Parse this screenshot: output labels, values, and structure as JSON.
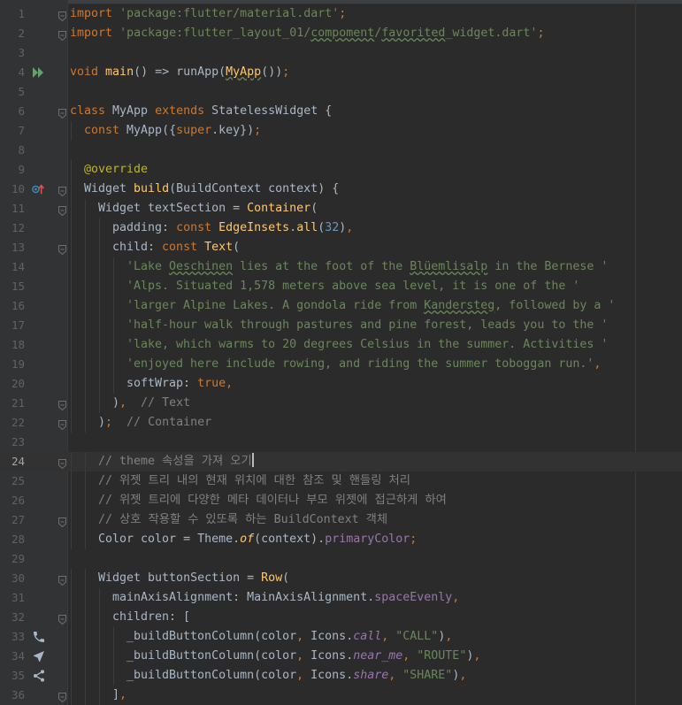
{
  "editor": {
    "current_line": 24,
    "lines": [
      {
        "n": "1",
        "tokens": [
          [
            "kw",
            "import"
          ],
          [
            "p",
            " "
          ],
          [
            "str",
            "'package:flutter/material.dart'"
          ],
          [
            "kw",
            ";"
          ]
        ],
        "fold": true
      },
      {
        "n": "2",
        "tokens": [
          [
            "kw",
            "import"
          ],
          [
            "p",
            " "
          ],
          [
            "str",
            "'package:flutter_layout_01/"
          ],
          [
            "strul",
            "compoment"
          ],
          [
            "str",
            "/"
          ],
          [
            "strul",
            "favorited"
          ],
          [
            "str",
            "_widget.dart'"
          ],
          [
            "kw",
            ";"
          ]
        ],
        "fold": true
      },
      {
        "n": "3",
        "tokens": []
      },
      {
        "n": "4",
        "tokens": [
          [
            "kw",
            "void"
          ],
          [
            "p",
            " "
          ],
          [
            "fn",
            "main"
          ],
          [
            "p",
            "() => runApp("
          ],
          [
            "fnul",
            "MyApp"
          ],
          [
            "p",
            "())"
          ],
          [
            "kw",
            ";"
          ]
        ],
        "icon": "run-icon"
      },
      {
        "n": "5",
        "tokens": []
      },
      {
        "n": "6",
        "tokens": [
          [
            "kw",
            "class"
          ],
          [
            "p",
            " MyApp "
          ],
          [
            "kw",
            "extends"
          ],
          [
            "p",
            " StatelessWidget {"
          ]
        ],
        "fold": true
      },
      {
        "n": "7",
        "indent": 1,
        "tokens": [
          [
            "kw",
            "const"
          ],
          [
            "p",
            " MyApp({"
          ],
          [
            "kw",
            "super"
          ],
          [
            "p",
            ".key})"
          ],
          [
            "kw",
            ";"
          ]
        ]
      },
      {
        "n": "8",
        "tokens": []
      },
      {
        "n": "9",
        "indent": 1,
        "tokens": [
          [
            "ann",
            "@override"
          ]
        ]
      },
      {
        "n": "10",
        "indent": 1,
        "tokens": [
          [
            "p",
            "Widget "
          ],
          [
            "fn",
            "build"
          ],
          [
            "p",
            "(BuildContext context) {"
          ]
        ],
        "icon": "override-icon",
        "fold": true
      },
      {
        "n": "11",
        "indent": 2,
        "tokens": [
          [
            "p",
            "Widget textSection = "
          ],
          [
            "fn",
            "Container"
          ],
          [
            "p",
            "("
          ]
        ],
        "fold": true
      },
      {
        "n": "12",
        "indent": 3,
        "tokens": [
          [
            "p",
            "padding: "
          ],
          [
            "kw",
            "const"
          ],
          [
            "p",
            " "
          ],
          [
            "fn",
            "EdgeInsets"
          ],
          [
            "p",
            "."
          ],
          [
            "fn",
            "all"
          ],
          [
            "p",
            "("
          ],
          [
            "num",
            "32"
          ],
          [
            "p",
            ")"
          ],
          [
            "kw",
            ","
          ]
        ]
      },
      {
        "n": "13",
        "indent": 3,
        "tokens": [
          [
            "p",
            "child: "
          ],
          [
            "kw",
            "const"
          ],
          [
            "p",
            " "
          ],
          [
            "fn",
            "Text"
          ],
          [
            "p",
            "("
          ]
        ],
        "fold": true
      },
      {
        "n": "14",
        "indent": 4,
        "tokens": [
          [
            "str",
            "'Lake "
          ],
          [
            "strul",
            "Oeschinen"
          ],
          [
            "str",
            " lies at the foot of the "
          ],
          [
            "strul",
            "Blüemlisalp"
          ],
          [
            "str",
            " in the Bernese '"
          ]
        ]
      },
      {
        "n": "15",
        "indent": 4,
        "tokens": [
          [
            "str",
            "'Alps. Situated 1,578 meters above sea level, it is one of the '"
          ]
        ]
      },
      {
        "n": "16",
        "indent": 4,
        "tokens": [
          [
            "str",
            "'larger Alpine Lakes. A gondola ride from "
          ],
          [
            "strul",
            "Kandersteg"
          ],
          [
            "str",
            ", followed by a '"
          ]
        ]
      },
      {
        "n": "17",
        "indent": 4,
        "tokens": [
          [
            "str",
            "'half-hour walk through pastures and pine forest, leads you to the '"
          ]
        ]
      },
      {
        "n": "18",
        "indent": 4,
        "tokens": [
          [
            "str",
            "'lake, which warms to 20 degrees Celsius in the summer. Activities '"
          ]
        ]
      },
      {
        "n": "19",
        "indent": 4,
        "tokens": [
          [
            "str",
            "'enjoyed here include rowing, and riding the summer toboggan run.'"
          ],
          [
            "kw",
            ","
          ]
        ]
      },
      {
        "n": "20",
        "indent": 4,
        "tokens": [
          [
            "p",
            "softWrap: "
          ],
          [
            "kw",
            "true"
          ],
          [
            "kw",
            ","
          ]
        ]
      },
      {
        "n": "21",
        "indent": 3,
        "tokens": [
          [
            "p",
            ")"
          ],
          [
            "kw",
            ","
          ],
          [
            "p",
            "  "
          ],
          [
            "cm",
            "// Text"
          ]
        ],
        "fold": true
      },
      {
        "n": "22",
        "indent": 2,
        "tokens": [
          [
            "p",
            ")"
          ],
          [
            "kw",
            ";"
          ],
          [
            "p",
            "  "
          ],
          [
            "cm",
            "// Container"
          ]
        ],
        "fold": true
      },
      {
        "n": "23",
        "tokens": []
      },
      {
        "n": "24",
        "indent": 2,
        "tokens": [
          [
            "cm",
            "// theme 속성을 가져 오기"
          ]
        ],
        "fold": true,
        "caret": true
      },
      {
        "n": "25",
        "indent": 2,
        "tokens": [
          [
            "cm",
            "// 위젯 트리 내의 현재 위치에 대한 참조 및 핸들링 처리"
          ]
        ]
      },
      {
        "n": "26",
        "indent": 2,
        "tokens": [
          [
            "cm",
            "// 위젯 트리에 다양한 메타 데이터나 부모 위젯에 접근하게 하여"
          ]
        ]
      },
      {
        "n": "27",
        "indent": 2,
        "tokens": [
          [
            "cm",
            "// 상호 작용할 수 있또록 하는 BuildContext 객체"
          ]
        ],
        "fold": true
      },
      {
        "n": "28",
        "indent": 2,
        "tokens": [
          [
            "p",
            "Color color = Theme."
          ],
          [
            "fnit",
            "of"
          ],
          [
            "p",
            "(context)."
          ],
          [
            "prop",
            "primaryColor"
          ],
          [
            "kw",
            ";"
          ]
        ]
      },
      {
        "n": "29",
        "tokens": []
      },
      {
        "n": "30",
        "indent": 2,
        "tokens": [
          [
            "p",
            "Widget buttonSection = "
          ],
          [
            "fn",
            "Row"
          ],
          [
            "p",
            "("
          ]
        ],
        "fold": true
      },
      {
        "n": "31",
        "indent": 3,
        "tokens": [
          [
            "p",
            "mainAxisAlignment: MainAxisAlignment."
          ],
          [
            "prop",
            "spaceEvenly"
          ],
          [
            "kw",
            ","
          ]
        ]
      },
      {
        "n": "32",
        "indent": 3,
        "tokens": [
          [
            "p",
            "children: ["
          ]
        ],
        "fold": true
      },
      {
        "n": "33",
        "indent": 4,
        "tokens": [
          [
            "p",
            "_buildButtonColumn(color"
          ],
          [
            "kw",
            ","
          ],
          [
            "p",
            " Icons."
          ],
          [
            "propit",
            "call"
          ],
          [
            "kw",
            ","
          ],
          [
            "p",
            " "
          ],
          [
            "str",
            "\"CALL\""
          ],
          [
            "p",
            ")"
          ],
          [
            "kw",
            ","
          ]
        ],
        "icon": "phone-icon"
      },
      {
        "n": "34",
        "indent": 4,
        "tokens": [
          [
            "p",
            "_buildButtonColumn(color"
          ],
          [
            "kw",
            ","
          ],
          [
            "p",
            " Icons."
          ],
          [
            "propit",
            "near_me"
          ],
          [
            "kw",
            ","
          ],
          [
            "p",
            " "
          ],
          [
            "str",
            "\"ROUTE\""
          ],
          [
            "p",
            ")"
          ],
          [
            "kw",
            ","
          ]
        ],
        "icon": "near-me-icon"
      },
      {
        "n": "35",
        "indent": 4,
        "tokens": [
          [
            "p",
            "_buildButtonColumn(color"
          ],
          [
            "kw",
            ","
          ],
          [
            "p",
            " Icons."
          ],
          [
            "propit",
            "share"
          ],
          [
            "kw",
            ","
          ],
          [
            "p",
            " "
          ],
          [
            "str",
            "\"SHARE\""
          ],
          [
            "p",
            ")"
          ],
          [
            "kw",
            ","
          ]
        ],
        "icon": "share-icon"
      },
      {
        "n": "36",
        "indent": 3,
        "tokens": [
          [
            "p",
            "]"
          ],
          [
            "kw",
            ","
          ]
        ],
        "fold": true
      }
    ]
  }
}
